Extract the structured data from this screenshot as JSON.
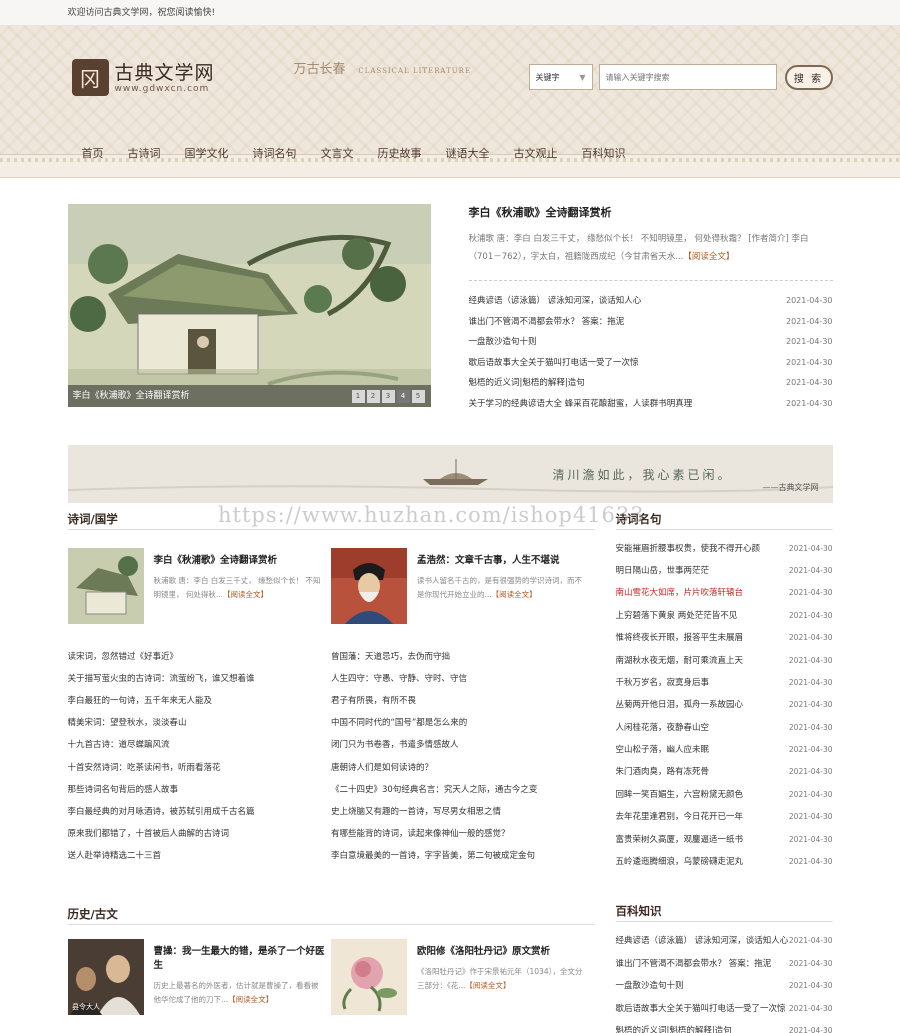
{
  "topbar": {
    "welcome": "欢迎访问古典文学网，祝您阅读愉快!"
  },
  "logo": {
    "icon_char": "冈",
    "name": "古典文学网",
    "url_text": "www.gdwxcn.com"
  },
  "deco": {
    "chars": "万古长春",
    "en": "CLASSICAL LITERATURE"
  },
  "search": {
    "select_value": "关键字",
    "placeholder": "请输入关键字搜索",
    "button": "搜 索"
  },
  "nav": [
    "首页",
    "古诗词",
    "国学文化",
    "诗词名句",
    "文言文",
    "历史故事",
    "谜语大全",
    "古文观止",
    "百科知识"
  ],
  "hero": {
    "slide_caption": "李白《秋浦歌》全诗翻译赏析",
    "dots": [
      "1",
      "2",
      "3",
      "4",
      "5"
    ],
    "active_dot": 4,
    "title": "李白《秋浦歌》全诗翻译赏析",
    "summary": "秋浦歌 唐：李白 白发三千丈， 缘愁似个长！ 不知明镜里， 何处得秋霜？ [作者简介] 李白（701－762），字太白，祖籍陇西成纪（今甘肃省天水...",
    "more": "【阅读全文】",
    "news": [
      {
        "title": "经典谚语（谚泳篇） 谚泳知河深，谈话知人心",
        "date": "2021-04-30"
      },
      {
        "title": "谁出门不管渴不渴都会带水？ 答案：拖泥",
        "date": "2021-04-30"
      },
      {
        "title": "一盘散沙造句十则",
        "date": "2021-04-30"
      },
      {
        "title": "歇后语故事大全关于猫叫打电话一受了一次惊",
        "date": "2021-04-30"
      },
      {
        "title": "魁梧的近义词|魁梧的解释|造句",
        "date": "2021-04-30"
      },
      {
        "title": "关于学习的经典谚语大全 蜂采百花酿甜蜜，人读群书明真理",
        "date": "2021-04-30"
      }
    ]
  },
  "banner": {
    "text": "清川澹如此，我心素已闲。",
    "sub": "——古典文学网"
  },
  "watermark": "https://www.huzhan.com/ishop41633",
  "poetry": {
    "heading": "诗词/国学",
    "features": [
      {
        "title": "李白《秋浦歌》全诗翻译赏析",
        "summary": "秋浦歌 唐：李白 白发三千丈， 缘愁似个长！ 不知明镜里， 何处得秋...",
        "more": "【阅读全文】"
      },
      {
        "title": "孟浩然：文章千古事，人生不堪说",
        "summary": "读书人留名千古的，是有很强势的学识诗词，而不是你现代开始立业的...",
        "more": "【阅读全文】"
      }
    ],
    "links_left": [
      "读宋词，忽然错过《好事近》",
      "关于描写萤火虫的古诗词：流萤纷飞，谁又想着谁",
      "李白最狂的一句诗，五千年来无人能及",
      "精美宋词：望登秋水，淡淡春山",
      "十九首古诗：道尽蝶蹁风流",
      "十首安然诗词：吃茶读闲书，听雨看落花",
      "那些诗词名句背后的感人故事",
      "李白最经典的对月咏酒诗，被苏轼引用成千古名篇",
      "原来我们都错了，十首被后人曲解的古诗词",
      "送人赴举诗精选二十三首"
    ],
    "links_right": [
      "曾国藩：天道忌巧，去伪而守拙",
      "人生四守：守愚、守静、守时、守信",
      "君子有所畏，有所不畏",
      "中国不同时代的“国号”都是怎么来的",
      "闭门只为书卷香，书遣多情感故人",
      "唐朝诗人们是如何读诗的？",
      "《二十四史》30句经典名言：究天人之际，通古今之变",
      "史上烧脑又有趣的一首诗，写尽男女相思之情",
      "有哪些能背的诗词，读起来像神仙一般的感觉？",
      "李白意境最美的一首诗，字字皆美，第二句被成定金句"
    ]
  },
  "famous": {
    "heading": "诗词名句",
    "items": [
      {
        "title": "安能摧眉折腰事权贵，使我不得开心颜",
        "date": "2021-04-30"
      },
      {
        "title": "明日隔山岳，世事两茫茫",
        "date": "2021-04-30"
      },
      {
        "title": "南山雪花大如席，片片吹落轩辕台",
        "date": "2021-04-30",
        "highlight": true
      },
      {
        "title": "上穷碧落下黄泉 两处茫茫皆不见",
        "date": "2021-04-30"
      },
      {
        "title": "惟将终夜长开眼，报答平生未展眉",
        "date": "2021-04-30"
      },
      {
        "title": "南湖秋水夜无烟，耐可乘流直上天",
        "date": "2021-04-30"
      },
      {
        "title": "千秋万岁名，寂寞身后事",
        "date": "2021-04-30"
      },
      {
        "title": "丛菊两开他日泪，孤舟一系故园心",
        "date": "2021-04-30"
      },
      {
        "title": "人闲桂花落，夜静春山空",
        "date": "2021-04-30"
      },
      {
        "title": "空山松子落，幽人应未眠",
        "date": "2021-04-30"
      },
      {
        "title": "朱门酒肉臭，路有冻死骨",
        "date": "2021-04-30"
      },
      {
        "title": "回眸一笑百媚生，六宫粉黛无颜色",
        "date": "2021-04-30"
      },
      {
        "title": "去年花里逢君别，今日花开已一年",
        "date": "2021-04-30"
      },
      {
        "title": "富贵荣树久高厦，观鏖逼适一纸书",
        "date": "2021-04-30"
      },
      {
        "title": "五岭逶迤腾细浪，乌蒙磅礴走泥丸",
        "date": "2021-04-30"
      }
    ]
  },
  "history": {
    "heading": "历史/古文",
    "features": [
      {
        "title": "曹操：我一生最大的错，是杀了一个好医生",
        "summary": "历史上最著名的外医者，估计就是曹操了，看看被他华佗成了他的刀下...",
        "more": "【阅读全文】",
        "image_text": "县令大人"
      },
      {
        "title": "欧阳修《洛阳牡丹记》原文赏析",
        "summary": "《洛阳牡丹记》作于宋景祐元年（1034），全文分三部分：《花...",
        "more": "【阅读全文】"
      }
    ]
  },
  "encyclopedia": {
    "heading": "百科知识",
    "items": [
      {
        "title": "经典谚语（谚泳篇） 谚泳知河深，谈话知人心",
        "date": "2021-04-30"
      },
      {
        "title": "谁出门不管渴不渴都会带水？ 答案：拖泥",
        "date": "2021-04-30"
      },
      {
        "title": "一盘散沙造句十则",
        "date": "2021-04-30"
      },
      {
        "title": "歇后语故事大全关于猫叫打电话一受了一次惊",
        "date": "2021-04-30"
      },
      {
        "title": "魁梧的近义词|魁梧的解释|造句",
        "date": "2021-04-30"
      }
    ]
  }
}
